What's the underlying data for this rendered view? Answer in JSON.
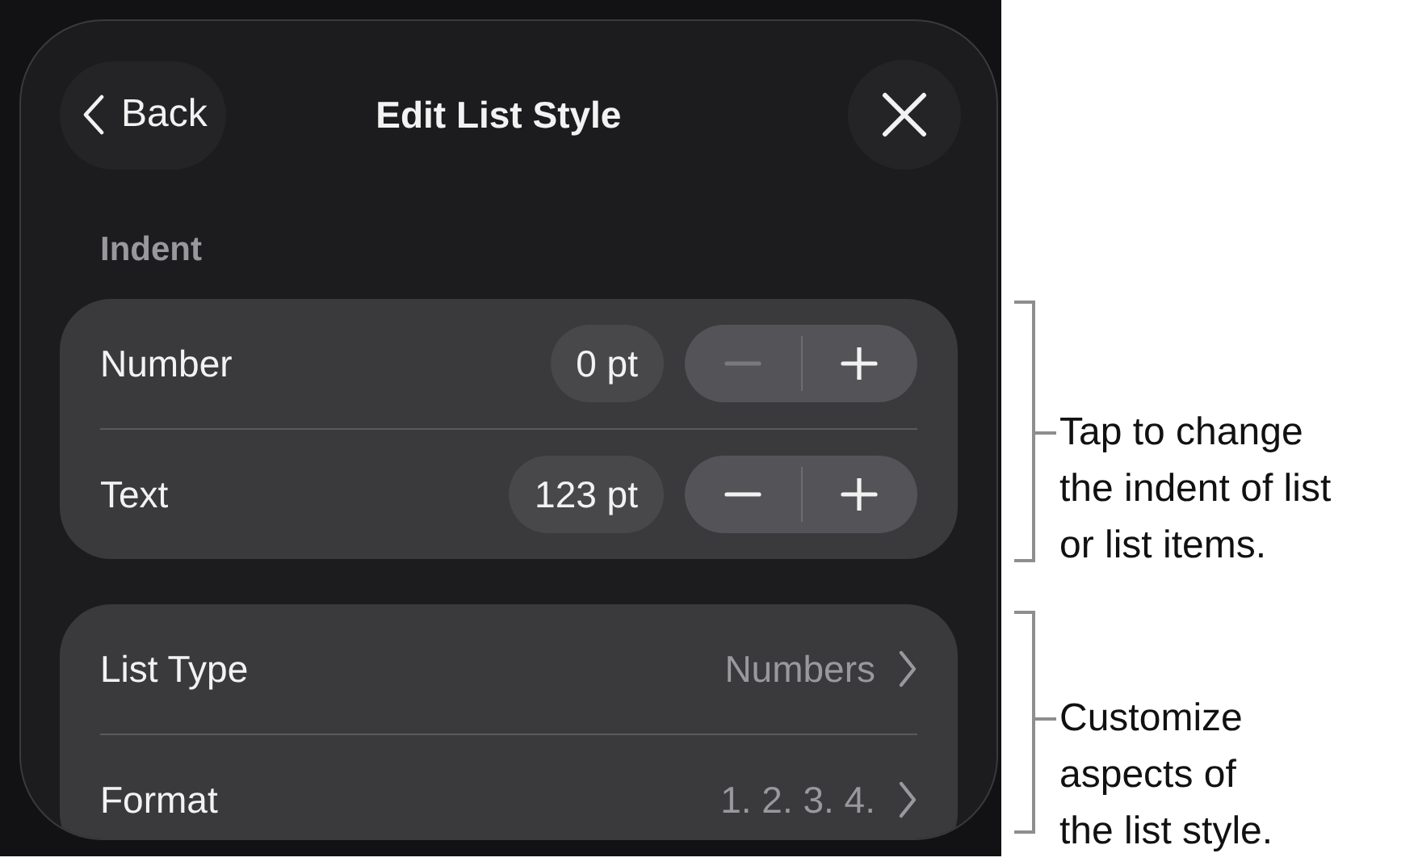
{
  "header": {
    "back_label": "Back",
    "title": "Edit List Style"
  },
  "section_label": "Indent",
  "indent_rows": [
    {
      "label": "Number",
      "value": "0 pt",
      "minus_disabled": true,
      "plus_disabled": false
    },
    {
      "label": "Text",
      "value": "123 pt",
      "minus_disabled": false,
      "plus_disabled": false
    }
  ],
  "list_rows": [
    {
      "label": "List Type",
      "value": "Numbers"
    },
    {
      "label": "Format",
      "value": "1. 2. 3. 4."
    }
  ],
  "callouts": [
    {
      "lines": [
        "Tap to change",
        "the indent of list",
        "or list items."
      ]
    },
    {
      "lines": [
        "Customize",
        "aspects of",
        "the list style."
      ]
    }
  ]
}
